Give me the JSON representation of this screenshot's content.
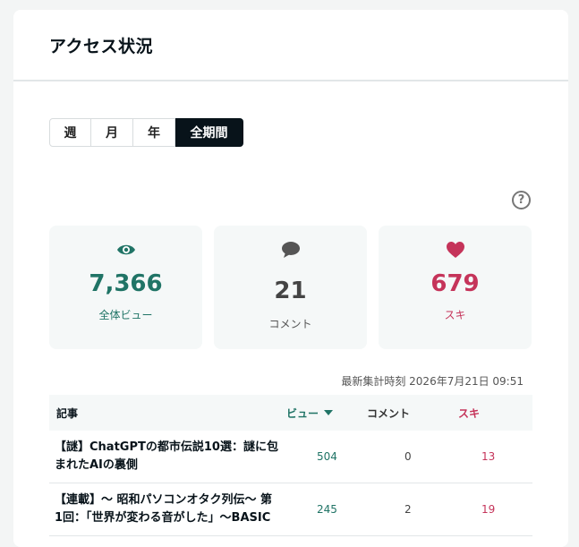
{
  "header": {
    "title": "アクセス状況"
  },
  "tabs": [
    {
      "label": "週",
      "active": false
    },
    {
      "label": "月",
      "active": false
    },
    {
      "label": "年",
      "active": false
    },
    {
      "label": "全期間",
      "active": true
    }
  ],
  "help": {
    "glyph": "?"
  },
  "stats": {
    "views": {
      "value": "7,366",
      "label": "全体ビュー",
      "icon": "eye-icon",
      "color": "#207466"
    },
    "comments": {
      "value": "21",
      "label": "コメント",
      "icon": "comment-icon",
      "color": "#444444"
    },
    "likes": {
      "value": "679",
      "label": "スキ",
      "icon": "heart-icon",
      "color": "#c5345a"
    }
  },
  "updated": "最新集計時刻 2026年7月21日 09:51",
  "table": {
    "headers": {
      "title": "記事",
      "views": "ビュー",
      "comments": "コメント",
      "likes": "スキ"
    },
    "rows": [
      {
        "title": "【謎】ChatGPTの都市伝説10選：謎に包まれたAIの裏側",
        "views": "504",
        "comments": "0",
        "likes": "13"
      },
      {
        "title": "【連載】〜 昭和パソコンオタク列伝〜 第1回：「世界が変わる音がした」〜BASIC",
        "views": "245",
        "comments": "2",
        "likes": "19"
      }
    ]
  }
}
